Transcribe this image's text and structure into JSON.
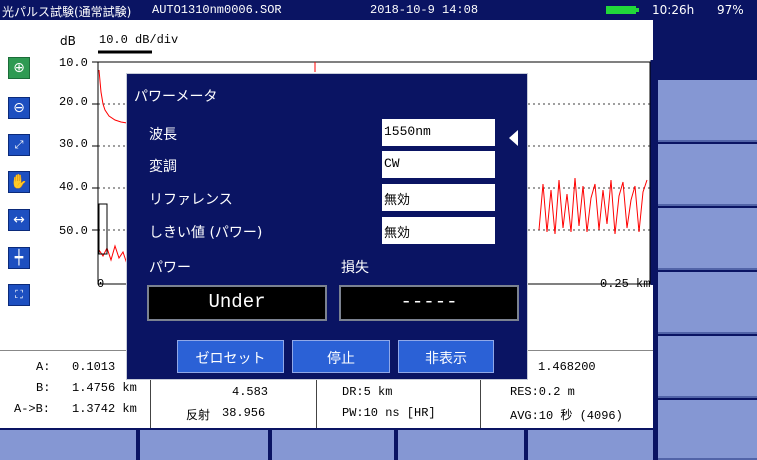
{
  "topbar": {
    "title": "光パルス試験(通常試験)",
    "filename": "AUTO1310nm0006.SOR",
    "datetime": "2018-10-9 14:08",
    "elapsed": "10:26h",
    "battery": "97%",
    "battery_level": 0.97,
    "battery_color": "#22d83a"
  },
  "chart": {
    "y_unit": "dB",
    "scale": "10.0 dB/div",
    "y_ticks": [
      "10.0",
      "20.0",
      "30.0",
      "40.0",
      "50.0"
    ],
    "x_start": "0",
    "x_end": "0.25 km",
    "trace_color": "#ff0000"
  },
  "toolbar": {
    "icons": [
      "zoom-in-icon",
      "zoom-out-icon",
      "fit-screen-icon",
      "hand-pan-icon",
      "horizontal-marker-icon",
      "vertical-marker-icon",
      "full-screen-icon"
    ]
  },
  "info": {
    "a_label": "A:",
    "a_value": "0.1013",
    "b_label": "B:",
    "b_value": "1.4756 km",
    "ab_label": "A->B:",
    "ab_value": "1.3742 km",
    "loss_value": "4.583",
    "reflect_label": "反射",
    "reflect_value": "38.956",
    "dr": "DR:5 km",
    "pw": "PW:10 ns [HR]",
    "ior": "1.468200",
    "res": "RES:0.2 m",
    "avg": "AVG:10 秒 (4096)"
  },
  "dialog": {
    "title": "パワーメータ",
    "wavelength_label": "波長",
    "wavelength_value": "1550nm",
    "modulation_label": "変調",
    "modulation_value": "CW",
    "reference_label": "リファレンス",
    "reference_value": "無効",
    "threshold_label": "しきい値 (パワー)",
    "threshold_value": "無効",
    "power_label": "パワー",
    "loss_label": "損失",
    "power_reading": "Under",
    "loss_reading": "-----",
    "zero_button": "ゼロセット",
    "stop_button": "停止",
    "hide_button": "非表示"
  }
}
